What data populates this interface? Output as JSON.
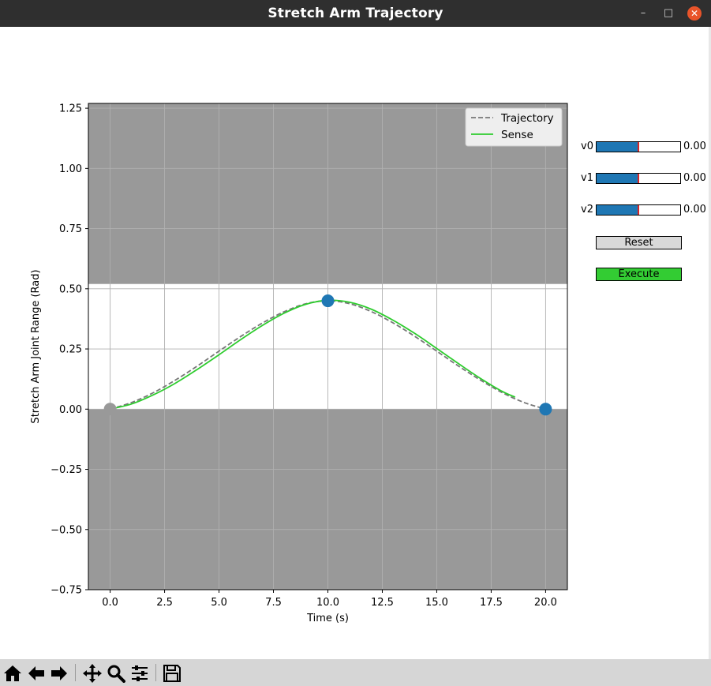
{
  "window": {
    "title": "Stretch Arm Trajectory",
    "minimize_glyph": "–",
    "maximize_glyph": "□",
    "close_glyph": "✕"
  },
  "chart_data": {
    "type": "line",
    "xlabel": "Time (s)",
    "ylabel": "Stretch Arm Joint Range (Rad)",
    "xlim": [
      -1,
      21
    ],
    "ylim": [
      -0.75,
      1.27
    ],
    "x_ticks": [
      0.0,
      2.5,
      5.0,
      7.5,
      10.0,
      12.5,
      15.0,
      17.5,
      20.0
    ],
    "x_tick_labels": [
      "0.0",
      "2.5",
      "5.0",
      "7.5",
      "10.0",
      "12.5",
      "15.0",
      "17.5",
      "20.0"
    ],
    "y_ticks": [
      -0.75,
      -0.5,
      -0.25,
      0.0,
      0.25,
      0.5,
      0.75,
      1.0,
      1.25
    ],
    "y_tick_labels": [
      "−0.75",
      "−0.50",
      "−0.25",
      "0.00",
      "0.25",
      "0.50",
      "0.75",
      "1.00",
      "1.25"
    ],
    "grid": true,
    "legend_position": "top-right",
    "invalid_regions": [
      {
        "y_from": 0.52,
        "y_to": 1.27,
        "color": "#999999"
      },
      {
        "y_from": -0.75,
        "y_to": 0.0,
        "color": "#999999"
      }
    ],
    "series": [
      {
        "name": "Trajectory",
        "style": "dashed",
        "color": "#777777",
        "x": [
          0,
          1,
          2,
          3,
          4,
          5,
          6,
          7,
          8,
          9,
          10,
          11,
          12,
          13,
          14,
          15,
          16,
          17,
          18,
          19,
          20
        ],
        "y": [
          0.0,
          0.028,
          0.069,
          0.121,
          0.179,
          0.241,
          0.302,
          0.358,
          0.405,
          0.438,
          0.45,
          0.438,
          0.405,
          0.358,
          0.302,
          0.241,
          0.179,
          0.121,
          0.069,
          0.028,
          0.0
        ]
      },
      {
        "name": "Sense",
        "style": "solid",
        "color": "#2ecc2e",
        "x": [
          0,
          1,
          2,
          3,
          4,
          5,
          6,
          7,
          8,
          9,
          10,
          11,
          12,
          13,
          14,
          15,
          16,
          17,
          18,
          18.6
        ],
        "y": [
          0.0,
          0.022,
          0.06,
          0.108,
          0.165,
          0.226,
          0.289,
          0.348,
          0.399,
          0.436,
          0.452,
          0.444,
          0.415,
          0.369,
          0.314,
          0.252,
          0.189,
          0.128,
          0.074,
          0.05
        ]
      }
    ],
    "waypoints": [
      {
        "x": 0.0,
        "y": 0.0,
        "color": "#999999"
      },
      {
        "x": 10.0,
        "y": 0.45,
        "color": "#1f77b4"
      },
      {
        "x": 20.0,
        "y": 0.0,
        "color": "#1f77b4"
      }
    ]
  },
  "controls": {
    "sliders": [
      {
        "label": "v0",
        "value_text": "0.00",
        "fill_fraction": 0.5
      },
      {
        "label": "v1",
        "value_text": "0.00",
        "fill_fraction": 0.5
      },
      {
        "label": "v2",
        "value_text": "0.00",
        "fill_fraction": 0.5
      }
    ],
    "reset_label": "Reset",
    "execute_label": "Execute",
    "colors": {
      "slider_fill": "#1f77b4",
      "slider_marker": "#d62728",
      "reset_bg": "#d9d9d9",
      "execute_bg": "#33cc33"
    }
  },
  "toolbar": {
    "icons": [
      "home-icon",
      "back-arrow-icon",
      "forward-arrow-icon",
      "pan-icon",
      "zoom-icon",
      "configure-subplots-icon",
      "save-icon"
    ]
  }
}
